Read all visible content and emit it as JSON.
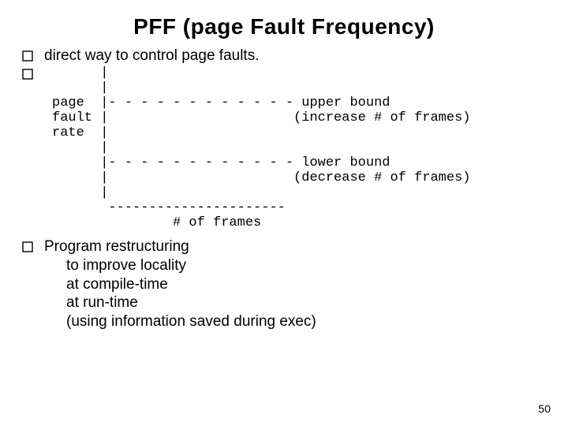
{
  "title": "PFF (page Fault Frequency)",
  "bullet1": "direct way to control page faults.",
  "diagram": "      |\n      |\npage  |- - - - - - - - - - - - upper bound\nfault |                       (increase # of frames)\nrate  |\n      |\n      |- - - - - - - - - - - - lower bound\n      |                       (decrease # of frames)\n      |\n       ----------------------\n               # of frames",
  "bullet2": "Program restructuring",
  "sub_lines": {
    "l1": "to improve locality",
    "l2": "at compile-time",
    "l3": "at run-time",
    "l4": "(using information saved during exec)"
  },
  "page_number": "50"
}
